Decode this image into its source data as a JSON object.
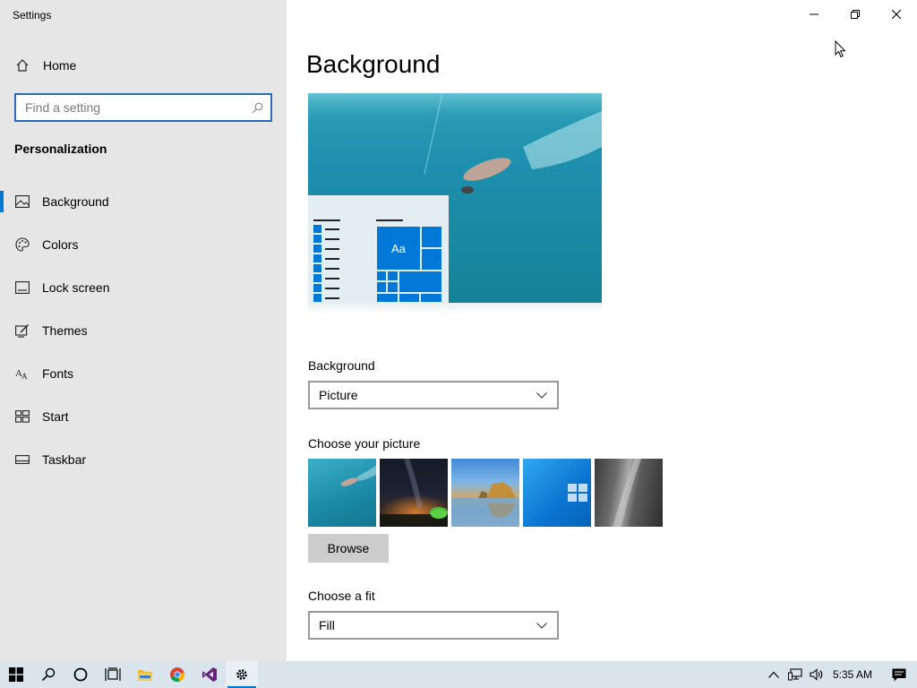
{
  "window": {
    "title": "Settings",
    "controls": {
      "minimize": "minimize",
      "restore": "restore",
      "close": "close"
    }
  },
  "sidebar": {
    "home_label": "Home",
    "search_placeholder": "Find a setting",
    "section_title": "Personalization",
    "items": [
      {
        "label": "Background",
        "icon": "picture-icon",
        "active": true
      },
      {
        "label": "Colors",
        "icon": "palette-icon",
        "active": false
      },
      {
        "label": "Lock screen",
        "icon": "lock-screen-icon",
        "active": false
      },
      {
        "label": "Themes",
        "icon": "themes-icon",
        "active": false
      },
      {
        "label": "Fonts",
        "icon": "fonts-icon",
        "active": false
      },
      {
        "label": "Start",
        "icon": "start-icon",
        "active": false
      },
      {
        "label": "Taskbar",
        "icon": "taskbar-icon",
        "active": false
      }
    ]
  },
  "main": {
    "title": "Background",
    "preview": {
      "tile_text": "Aa"
    },
    "background_label": "Background",
    "background_value": "Picture",
    "choose_picture_label": "Choose your picture",
    "browse_label": "Browse",
    "fit_label": "Choose a fit",
    "fit_value": "Fill"
  },
  "taskbar": {
    "icons": [
      "windows-start-icon",
      "search-icon",
      "cortana-icon",
      "task-view-icon",
      "file-explorer-icon",
      "chrome-icon",
      "visual-studio-icon",
      "settings-icon"
    ],
    "clock": "5:35 AM"
  },
  "colors": {
    "accent": "#0078d7",
    "sidebar_bg": "#e6e6e6",
    "taskbar_bg": "#d9e4ec"
  }
}
